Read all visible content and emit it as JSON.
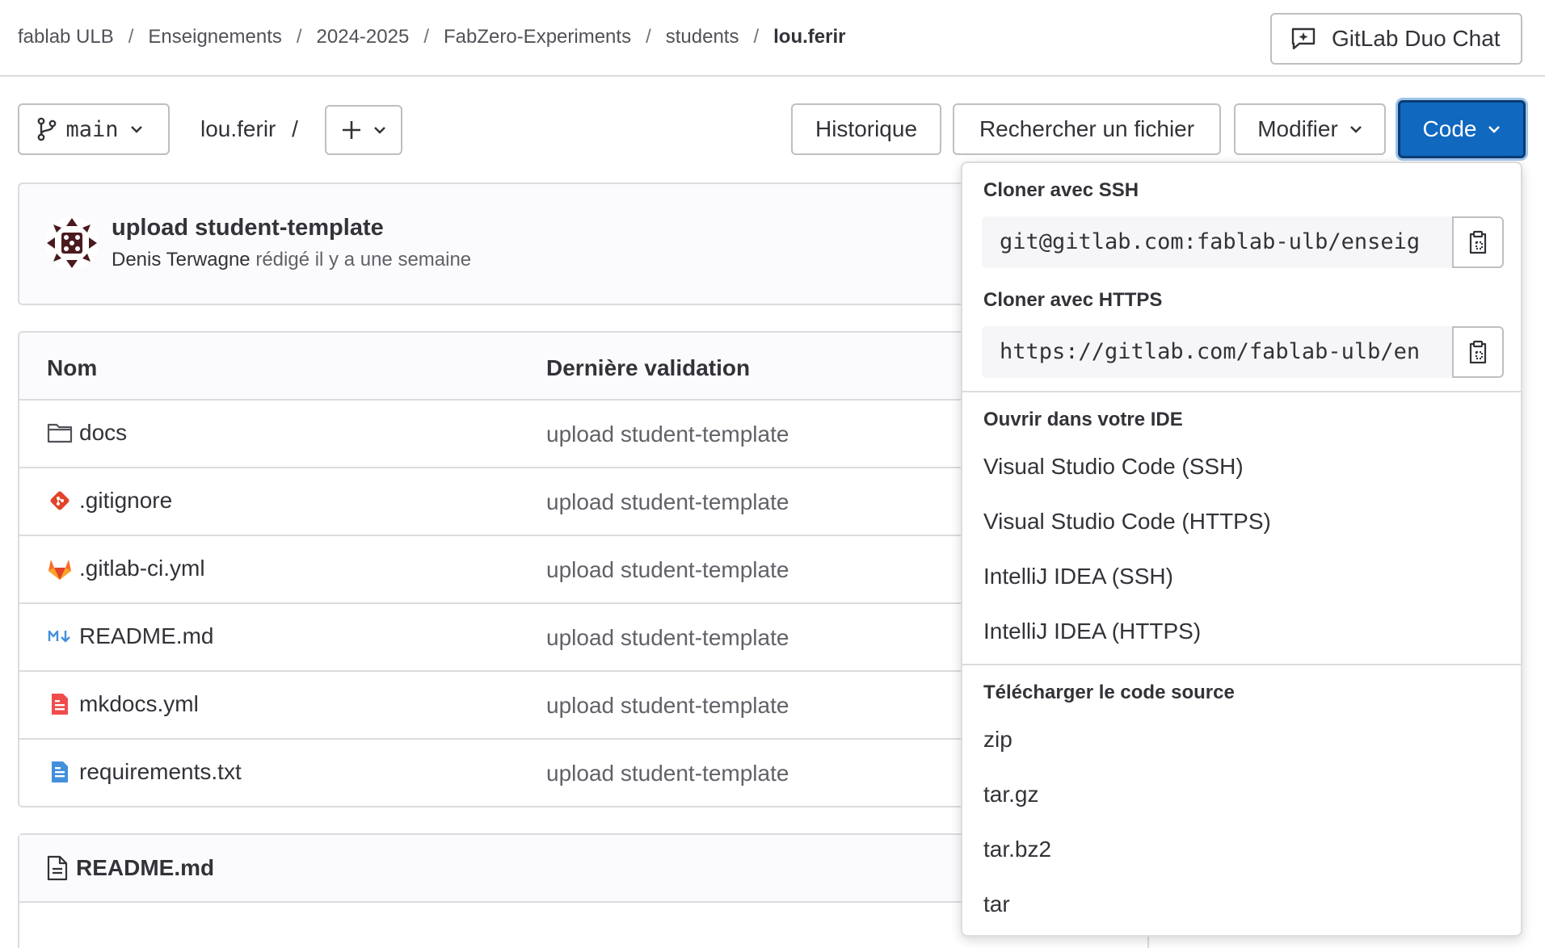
{
  "breadcrumb": {
    "items": [
      "fablab ULB",
      "Enseignements",
      "2024-2025",
      "FabZero-Experiments",
      "students"
    ],
    "current": "lou.ferir",
    "separator": "/"
  },
  "header": {
    "duo_chat_label": "GitLab Duo Chat"
  },
  "toolbar": {
    "branch": "main",
    "path": "lou.ferir",
    "path_sep": "/",
    "history_label": "Historique",
    "find_file_label": "Rechercher un fichier",
    "edit_label": "Modifier",
    "code_label": "Code"
  },
  "commit": {
    "title": "upload student-template",
    "author": "Denis Terwagne",
    "meta": "rédigé il y a une semaine"
  },
  "file_table": {
    "columns": [
      "Nom",
      "Dernière validation"
    ],
    "rows": [
      {
        "name": "docs",
        "icon": "folder-icon",
        "commit": "upload student-template"
      },
      {
        "name": ".gitignore",
        "icon": "git-icon",
        "commit": "upload student-template"
      },
      {
        "name": ".gitlab-ci.yml",
        "icon": "gitlab-icon",
        "commit": "upload student-template"
      },
      {
        "name": "README.md",
        "icon": "markdown-icon",
        "commit": "upload student-template"
      },
      {
        "name": "mkdocs.yml",
        "icon": "yaml-file-icon",
        "commit": "upload student-template"
      },
      {
        "name": "requirements.txt",
        "icon": "text-file-icon",
        "commit": "upload student-template"
      }
    ]
  },
  "readme": {
    "title": "README.md"
  },
  "code_dropdown": {
    "ssh_title": "Cloner avec SSH",
    "ssh_url": "git@gitlab.com:fablab-ulb/enseig",
    "https_title": "Cloner avec HTTPS",
    "https_url": "https://gitlab.com/fablab-ulb/en",
    "ide_title": "Ouvrir dans votre IDE",
    "ide_items": [
      "Visual Studio Code (SSH)",
      "Visual Studio Code (HTTPS)",
      "IntelliJ IDEA (SSH)",
      "IntelliJ IDEA (HTTPS)"
    ],
    "download_title": "Télécharger le code source",
    "download_items": [
      "zip",
      "tar.gz",
      "tar.bz2",
      "tar"
    ]
  },
  "colors": {
    "primary": "#1068bf",
    "border": "#dcdcde",
    "text": "#333238",
    "muted": "#626168"
  }
}
